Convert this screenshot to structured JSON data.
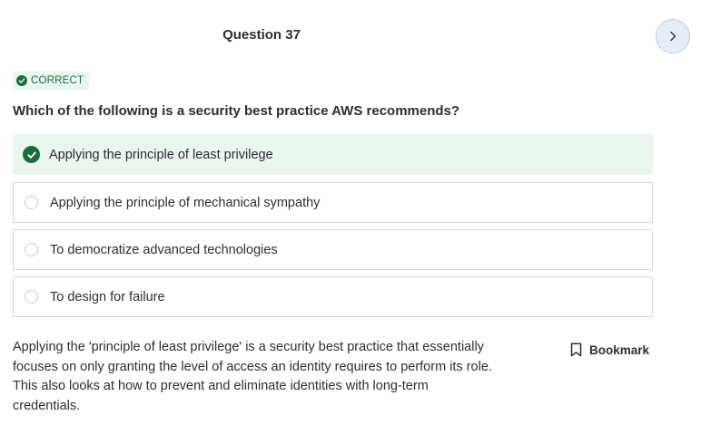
{
  "header": {
    "title": "Question 37"
  },
  "navigation": {
    "next_icon": "chevron-right-icon"
  },
  "result": {
    "badge_label": "CORRECT",
    "icon": "check-circle-icon",
    "color": "#1e6b40"
  },
  "question": {
    "text": "Which of the following is a security best practice AWS recommends?"
  },
  "options": [
    {
      "label": "Applying the principle of least privilege",
      "state": "correct"
    },
    {
      "label": "Applying the principle of mechanical sympathy",
      "state": "unselected"
    },
    {
      "label": "To democratize advanced technologies",
      "state": "unselected"
    },
    {
      "label": "To design for failure",
      "state": "unselected"
    }
  ],
  "explanation": {
    "lines": [
      "Applying the 'principle of least privilege' is a security best practice that essentially",
      "focuses on only granting the level of access an identity requires to perform its role.",
      "This also looks at how to prevent and eliminate identities with long-term",
      "credentials."
    ]
  },
  "bookmark": {
    "label": "Bookmark",
    "icon": "bookmark-icon"
  },
  "colors": {
    "correct_bg": "#e9f6ee",
    "accent": "#1e6b40",
    "border": "#d1d7dc"
  }
}
